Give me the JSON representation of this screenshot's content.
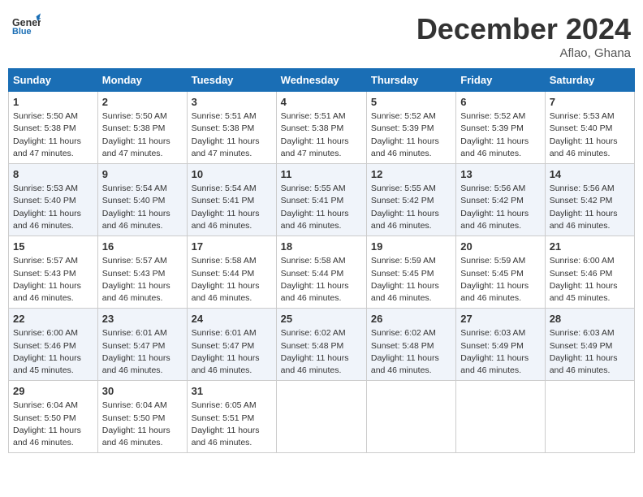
{
  "header": {
    "logo_general": "General",
    "logo_blue": "Blue",
    "title": "December 2024",
    "location": "Aflao, Ghana"
  },
  "days_of_week": [
    "Sunday",
    "Monday",
    "Tuesday",
    "Wednesday",
    "Thursday",
    "Friday",
    "Saturday"
  ],
  "weeks": [
    [
      {
        "day": "1",
        "info": "Sunrise: 5:50 AM\nSunset: 5:38 PM\nDaylight: 11 hours and 47 minutes."
      },
      {
        "day": "2",
        "info": "Sunrise: 5:50 AM\nSunset: 5:38 PM\nDaylight: 11 hours and 47 minutes."
      },
      {
        "day": "3",
        "info": "Sunrise: 5:51 AM\nSunset: 5:38 PM\nDaylight: 11 hours and 47 minutes."
      },
      {
        "day": "4",
        "info": "Sunrise: 5:51 AM\nSunset: 5:38 PM\nDaylight: 11 hours and 47 minutes."
      },
      {
        "day": "5",
        "info": "Sunrise: 5:52 AM\nSunset: 5:39 PM\nDaylight: 11 hours and 46 minutes."
      },
      {
        "day": "6",
        "info": "Sunrise: 5:52 AM\nSunset: 5:39 PM\nDaylight: 11 hours and 46 minutes."
      },
      {
        "day": "7",
        "info": "Sunrise: 5:53 AM\nSunset: 5:40 PM\nDaylight: 11 hours and 46 minutes."
      }
    ],
    [
      {
        "day": "8",
        "info": "Sunrise: 5:53 AM\nSunset: 5:40 PM\nDaylight: 11 hours and 46 minutes."
      },
      {
        "day": "9",
        "info": "Sunrise: 5:54 AM\nSunset: 5:40 PM\nDaylight: 11 hours and 46 minutes."
      },
      {
        "day": "10",
        "info": "Sunrise: 5:54 AM\nSunset: 5:41 PM\nDaylight: 11 hours and 46 minutes."
      },
      {
        "day": "11",
        "info": "Sunrise: 5:55 AM\nSunset: 5:41 PM\nDaylight: 11 hours and 46 minutes."
      },
      {
        "day": "12",
        "info": "Sunrise: 5:55 AM\nSunset: 5:42 PM\nDaylight: 11 hours and 46 minutes."
      },
      {
        "day": "13",
        "info": "Sunrise: 5:56 AM\nSunset: 5:42 PM\nDaylight: 11 hours and 46 minutes."
      },
      {
        "day": "14",
        "info": "Sunrise: 5:56 AM\nSunset: 5:42 PM\nDaylight: 11 hours and 46 minutes."
      }
    ],
    [
      {
        "day": "15",
        "info": "Sunrise: 5:57 AM\nSunset: 5:43 PM\nDaylight: 11 hours and 46 minutes."
      },
      {
        "day": "16",
        "info": "Sunrise: 5:57 AM\nSunset: 5:43 PM\nDaylight: 11 hours and 46 minutes."
      },
      {
        "day": "17",
        "info": "Sunrise: 5:58 AM\nSunset: 5:44 PM\nDaylight: 11 hours and 46 minutes."
      },
      {
        "day": "18",
        "info": "Sunrise: 5:58 AM\nSunset: 5:44 PM\nDaylight: 11 hours and 46 minutes."
      },
      {
        "day": "19",
        "info": "Sunrise: 5:59 AM\nSunset: 5:45 PM\nDaylight: 11 hours and 46 minutes."
      },
      {
        "day": "20",
        "info": "Sunrise: 5:59 AM\nSunset: 5:45 PM\nDaylight: 11 hours and 46 minutes."
      },
      {
        "day": "21",
        "info": "Sunrise: 6:00 AM\nSunset: 5:46 PM\nDaylight: 11 hours and 45 minutes."
      }
    ],
    [
      {
        "day": "22",
        "info": "Sunrise: 6:00 AM\nSunset: 5:46 PM\nDaylight: 11 hours and 45 minutes."
      },
      {
        "day": "23",
        "info": "Sunrise: 6:01 AM\nSunset: 5:47 PM\nDaylight: 11 hours and 46 minutes."
      },
      {
        "day": "24",
        "info": "Sunrise: 6:01 AM\nSunset: 5:47 PM\nDaylight: 11 hours and 46 minutes."
      },
      {
        "day": "25",
        "info": "Sunrise: 6:02 AM\nSunset: 5:48 PM\nDaylight: 11 hours and 46 minutes."
      },
      {
        "day": "26",
        "info": "Sunrise: 6:02 AM\nSunset: 5:48 PM\nDaylight: 11 hours and 46 minutes."
      },
      {
        "day": "27",
        "info": "Sunrise: 6:03 AM\nSunset: 5:49 PM\nDaylight: 11 hours and 46 minutes."
      },
      {
        "day": "28",
        "info": "Sunrise: 6:03 AM\nSunset: 5:49 PM\nDaylight: 11 hours and 46 minutes."
      }
    ],
    [
      {
        "day": "29",
        "info": "Sunrise: 6:04 AM\nSunset: 5:50 PM\nDaylight: 11 hours and 46 minutes."
      },
      {
        "day": "30",
        "info": "Sunrise: 6:04 AM\nSunset: 5:50 PM\nDaylight: 11 hours and 46 minutes."
      },
      {
        "day": "31",
        "info": "Sunrise: 6:05 AM\nSunset: 5:51 PM\nDaylight: 11 hours and 46 minutes."
      },
      {
        "day": "",
        "info": ""
      },
      {
        "day": "",
        "info": ""
      },
      {
        "day": "",
        "info": ""
      },
      {
        "day": "",
        "info": ""
      }
    ]
  ]
}
